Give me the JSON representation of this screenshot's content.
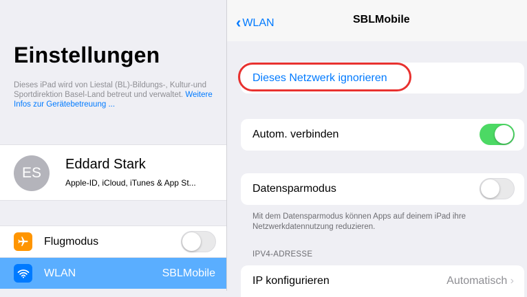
{
  "sidebar": {
    "title": "Einstellungen",
    "supervision_text": "Dieses iPad wird von Liestal (BL)-Bildungs-, Kultur-und Sportdirektion Basel-Land betreut und verwaltet.",
    "supervision_link": "Weitere Infos zur Gerätebetreuung ...",
    "account": {
      "initials": "ES",
      "name": "Eddard Stark",
      "subtitle": "Apple-ID, iCloud, iTunes & App St..."
    },
    "items": [
      {
        "label": "Flugmodus",
        "icon": "airplane-icon",
        "toggle_on": false
      },
      {
        "label": "WLAN",
        "value": "SBLMobile",
        "icon": "wifi-icon",
        "selected": true
      }
    ]
  },
  "detail": {
    "back_label": "WLAN",
    "title": "SBLMobile",
    "forget_label": "Dieses Netzwerk ignorieren",
    "auto_join_label": "Autom. verbinden",
    "auto_join_on": true,
    "low_data_label": "Datensparmodus",
    "low_data_on": false,
    "low_data_footer": "Mit dem Datensparmodus können Apps auf deinem iPad ihre Netzwerkdatennutzung reduzieren.",
    "ipv4_header": "IPV4-ADRESSE",
    "ip_config_label": "IP konfigurieren",
    "ip_config_value": "Automatisch"
  },
  "colors": {
    "accent": "#007aff",
    "toggle_on": "#4cd964",
    "selection": "#5aaeff",
    "highlight_ring": "#e8312f"
  }
}
